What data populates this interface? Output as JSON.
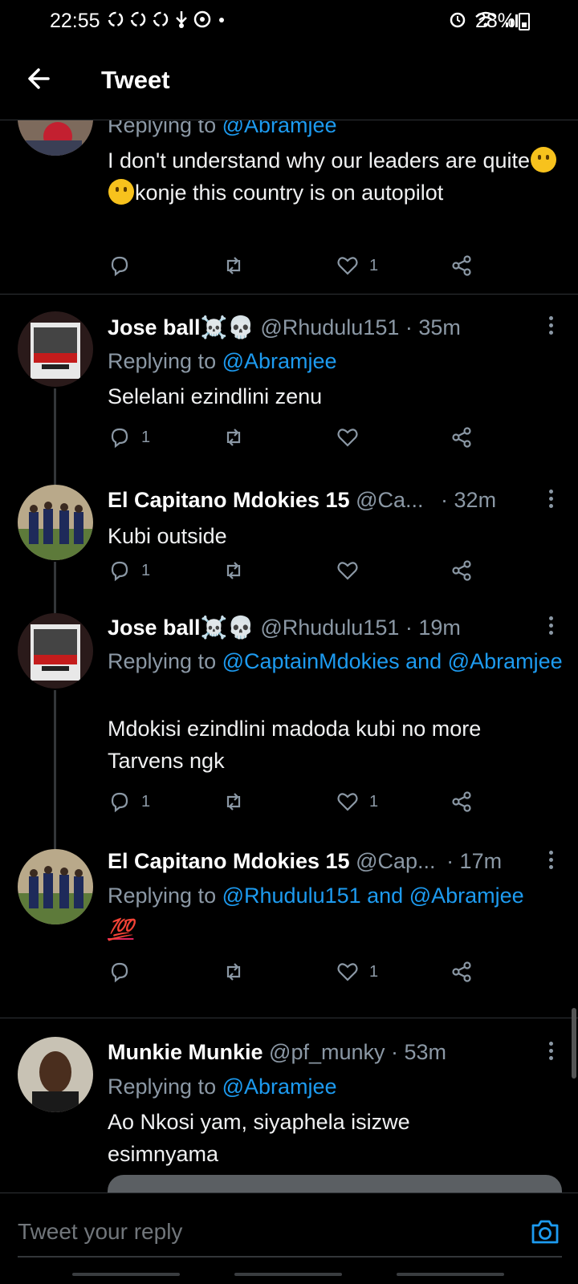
{
  "status_bar": {
    "time": "22:55",
    "battery": "28%",
    "notification_icons": [
      "sync-icon",
      "sync-icon",
      "sync-icon",
      "usb-icon",
      "messenger-icon",
      "dot-icon"
    ],
    "system_icons": [
      "alarm-icon",
      "wifi-icon",
      "signal-icon"
    ]
  },
  "header": {
    "title": "Tweet"
  },
  "tweets": [
    {
      "reply_prefix": "Replying to",
      "mentions": "@Abramjee",
      "body_parts": [
        "I don't understand why our leaders are quite",
        "konje this country is on autopilot"
      ],
      "likes": "1",
      "replies": "",
      "avatar_colors": [
        "#8a6a5a",
        "#c32030"
      ]
    },
    {
      "name": "Jose ball☠️💀",
      "handle": "@Rhudulu151",
      "time": "· 35m",
      "reply_prefix": "Replying to",
      "mentions": "@Abramjee",
      "body": "Selelani ezindlini zenu",
      "replies": "1",
      "likes": ""
    },
    {
      "name": "El Capitano Mdokies 15",
      "handle": "@Ca...",
      "time": "· 32m",
      "body": "Kubi outside",
      "replies": "1",
      "likes": ""
    },
    {
      "name": "Jose ball☠️💀",
      "handle": "@Rhudulu151",
      "time": "· 19m",
      "reply_prefix": "Replying to",
      "mentions": "@CaptainMdokies and @Abramjee",
      "body": "Mdokisi ezindlini madoda kubi no more Tarvens ngk",
      "replies": "1",
      "likes": "1"
    },
    {
      "name": "El Capitano Mdokies 15",
      "handle": "@Cap...",
      "time": "· 17m",
      "reply_prefix": "Replying to",
      "mentions": "@Rhudulu151 and @Abramjee",
      "body": "💯",
      "replies": "",
      "likes": "1"
    },
    {
      "name": "Munkie Munkie",
      "handle": "@pf_munky",
      "time": "· 53m",
      "reply_prefix": "Replying to",
      "mentions": "@Abramjee",
      "body": "Ao Nkosi yam, siyaphela isizwe esimnyama"
    }
  ],
  "reply_bar": {
    "placeholder": "Tweet your reply"
  },
  "colors": {
    "background": "#000000",
    "accent": "#1d9bf0",
    "muted": "#8b98a5",
    "divider": "#2f3336"
  }
}
